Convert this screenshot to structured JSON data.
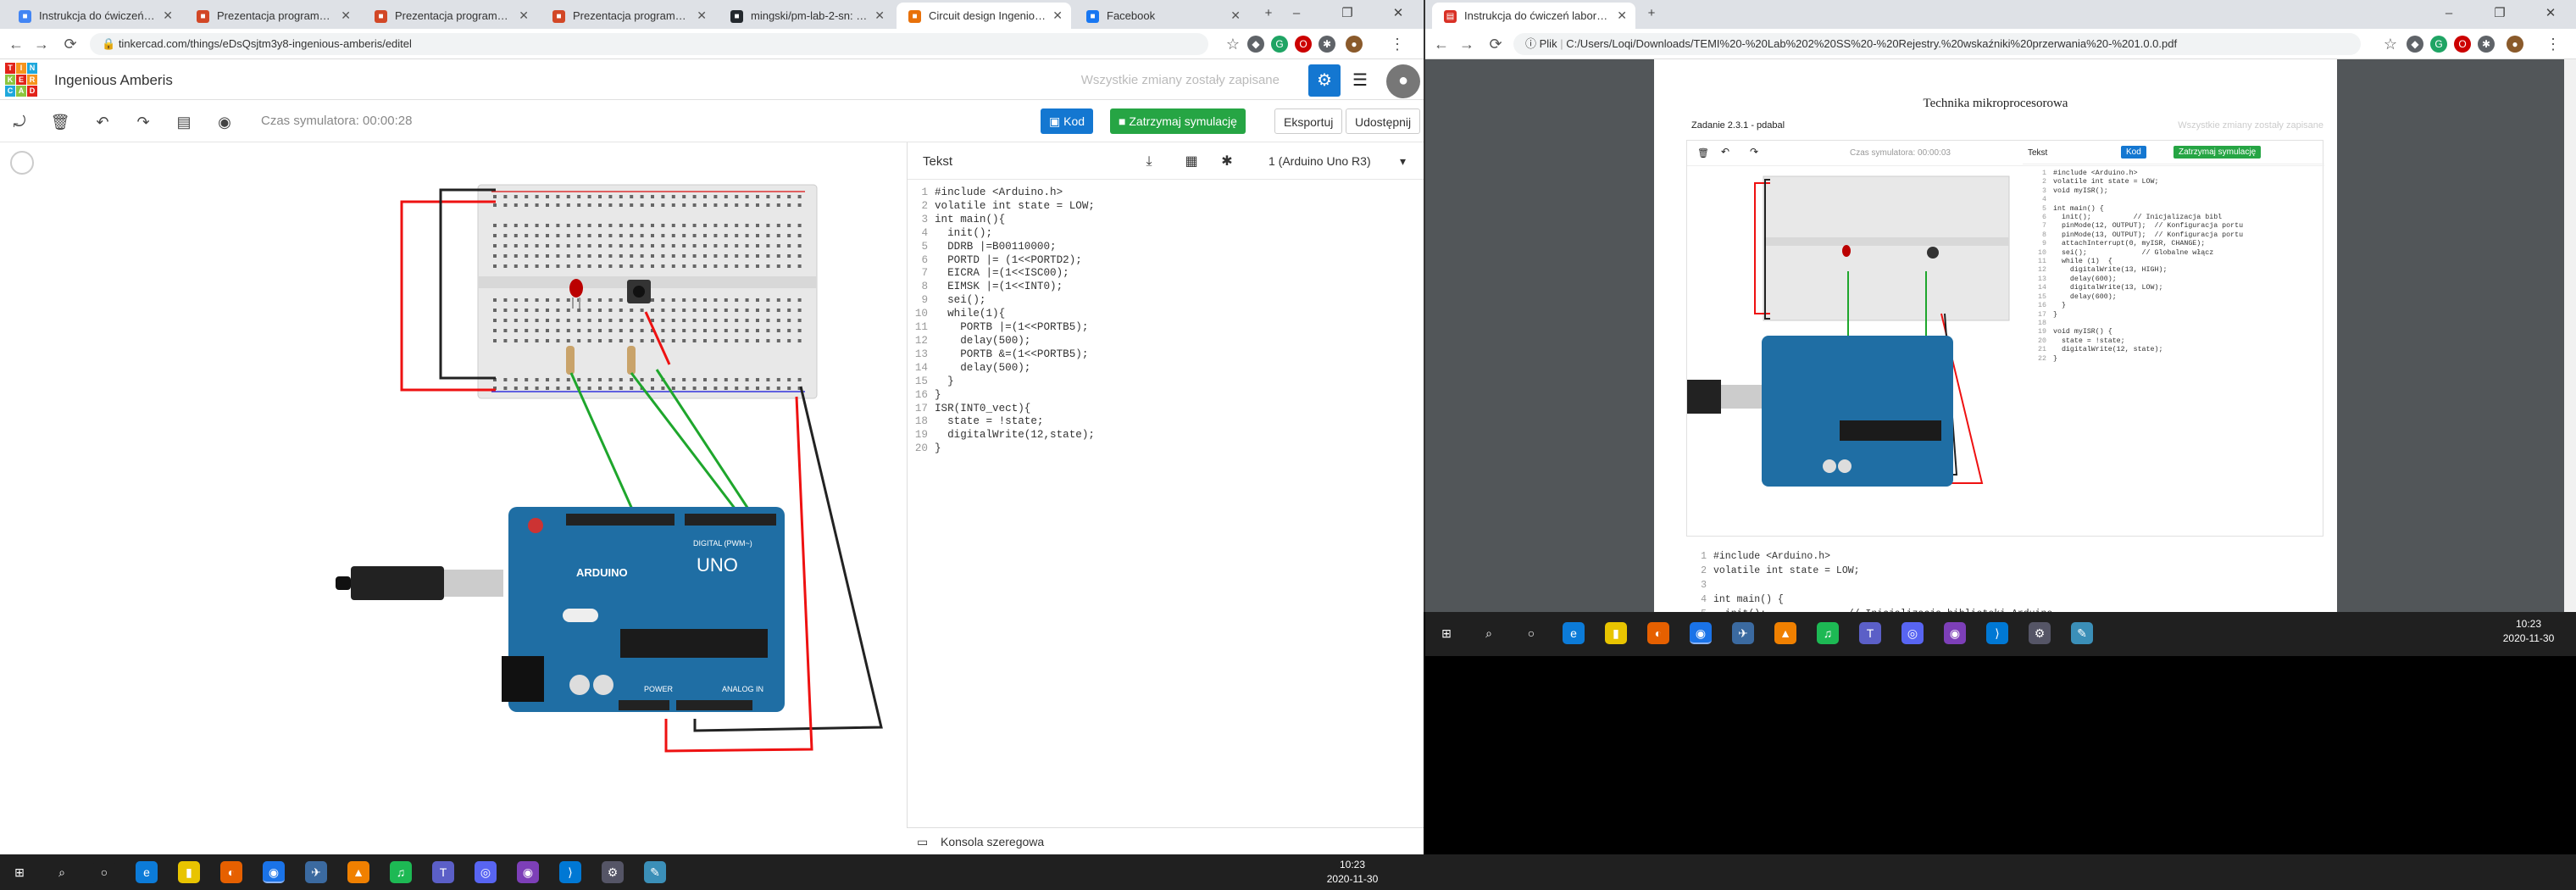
{
  "left_browser": {
    "tabs": [
      {
        "label": "Instrukcja do ćwiczeń labo",
        "color": "#4285f4",
        "icon": "document-icon"
      },
      {
        "label": "Prezentacja programu Pow",
        "color": "#d24726",
        "icon": "powerpoint-icon"
      },
      {
        "label": "Prezentacja programu Pow",
        "color": "#d24726",
        "icon": "powerpoint-icon"
      },
      {
        "label": "Prezentacja programu Pow",
        "color": "#d24726",
        "icon": "powerpoint-icon"
      },
      {
        "label": "mingski/pm-lab-2-sn: Repo",
        "color": "#24292e",
        "icon": "github-icon"
      },
      {
        "label": "Circuit design Ingenious Am",
        "color": "#e8710a",
        "icon": "tinkercad-icon"
      },
      {
        "label": "Facebook",
        "color": "#1877f2",
        "icon": "facebook-icon"
      }
    ],
    "new_tab": "+",
    "url": "tinkercad.com/things/eDsQsjtm3y8-ingenious-amberis/editel"
  },
  "tinkercad": {
    "logo_letters": [
      "T",
      "I",
      "N",
      "K",
      "E",
      "R",
      "C",
      "A",
      "D"
    ],
    "logo_colors": [
      "#e2231a",
      "#f7941d",
      "#1fa8dc",
      "#8dc63f",
      "#e2231a",
      "#f7941d",
      "#1fa8dc",
      "#8dc63f",
      "#e2231a"
    ],
    "title": "Ingenious Amberis",
    "saved_status": "Wszystkie zmiany zostały zapisane",
    "sim_time": "Czas symulatora: 00:00:28",
    "code_button": "Kod",
    "stop_button": "Zatrzymaj symulację",
    "export_button": "Eksportuj",
    "share_button": "Udostępnij",
    "code_panel_label": "Tekst",
    "board_select": "1 (Arduino Uno R3)",
    "serial_console": "Konsola szeregowa",
    "code_lines": [
      "#include <Arduino.h>",
      "volatile int state = LOW;",
      "int main(){",
      "  init();",
      "  DDRB |=B00110000;",
      "  PORTD |= (1<<PORTD2);",
      "  EICRA |=(1<<ISC00);",
      "  EIMSK |=(1<<INT0);",
      "  sei();",
      "  while(1){",
      "    PORTB |=(1<<PORTB5);",
      "    delay(500);",
      "    PORTB &=(1<<PORTB5);",
      "    delay(500);",
      "  }",
      "}",
      "ISR(INT0_vect){",
      "  state = !state;",
      "  digitalWrite(12,state);",
      "}"
    ],
    "arduino_labels": {
      "brand": "ARDUINO",
      "model": "UNO",
      "digital": "DIGITAL (PWM~)",
      "power": "POWER",
      "analog": "ANALOG IN"
    }
  },
  "right_browser": {
    "tab": "Instrukcja do ćwiczeń laboratory",
    "new_tab": "+",
    "file_label": "Plik",
    "url": "C:/Users/Loqi/Downloads/TEMI%20-%20Lab%202%20SS%20-%20Rejestry.%20wskaźniki%20przerwania%20-%201.0.0.pdf",
    "pdf": {
      "title": "Technika mikroprocesorowa",
      "subtitle": "Zadanie 2.3.1 - pdabal",
      "saved_status": "Wszystkie zmiany zostały zapisane",
      "sim_time": "Czas symulatora: 00:00:03",
      "code_button": "Kod",
      "stop_button": "Zatrzymaj symulację",
      "code_label": "Tekst",
      "mini_code": [
        "#include <Arduino.h>",
        "volatile int state = LOW;",
        "void myISR();",
        "",
        "int main() {",
        "  init();          // Inicjalizacja bibl",
        "  pinMode(12, OUTPUT);  // Konfiguracja portu",
        "  pinMode(13, OUTPUT);  // Konfiguracja portu",
        "  attachInterrupt(0, myISR, CHANGE);",
        "  sei();             // Globalne włącz",
        "  while (1)  {",
        "    digitalWrite(13, HIGH);",
        "    delay(600);",
        "    digitalWrite(13, LOW);",
        "    delay(600);",
        "  }",
        "}",
        "",
        "void myISR() {",
        "  state = !state;",
        "  digitalWrite(12, state);",
        "}"
      ],
      "body_code": [
        "#include <Arduino.h>",
        "volatile int state = LOW;",
        "",
        "int main() {",
        "  init();              // Inicjalizacja biblioteki Arduino"
      ]
    }
  },
  "taskbar": {
    "time": "10:23",
    "date": "2020-11-30"
  }
}
